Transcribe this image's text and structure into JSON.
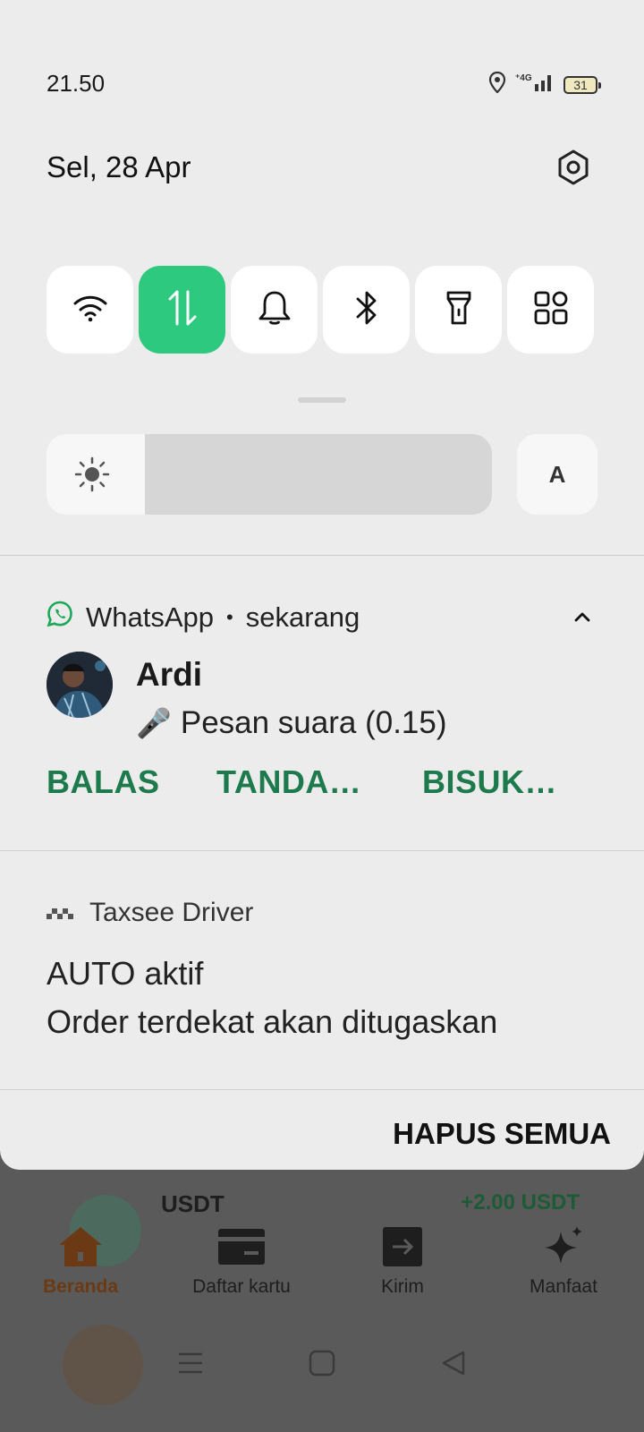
{
  "status_bar": {
    "time": "21.50",
    "network": "4G",
    "battery": "31"
  },
  "header": {
    "date": "Sel, 28 Apr"
  },
  "quick_tiles": [
    {
      "name": "wifi",
      "icon": "wifi-icon",
      "active": false
    },
    {
      "name": "mobile-data",
      "icon": "data-transfer-icon",
      "active": true
    },
    {
      "name": "sound",
      "icon": "bell-icon",
      "active": false
    },
    {
      "name": "bluetooth",
      "icon": "bluetooth-icon",
      "active": false
    },
    {
      "name": "flashlight",
      "icon": "flashlight-icon",
      "active": false
    },
    {
      "name": "more",
      "icon": "grid-icon",
      "active": false
    }
  ],
  "brightness": {
    "level": 0.22,
    "auto_label": "A"
  },
  "notifications": {
    "whatsapp": {
      "app": "WhatsApp",
      "separator": "•",
      "time": "sekarang",
      "sender": "Ardi",
      "emoji": "🎤",
      "message": "Pesan suara (0.15)",
      "actions": [
        "BALAS",
        "TANDA…",
        "BISUK…"
      ]
    },
    "taxsee": {
      "app": "Taxsee Driver",
      "title": "AUTO aktif",
      "text": "Order terdekat akan ditugaskan"
    }
  },
  "clear_all_label": "HAPUS SEMUA",
  "background_app": {
    "row_title": "USDT",
    "row_amount": "+2.00 USDT",
    "nav": [
      {
        "label": "Beranda",
        "icon": "home-icon",
        "active": true
      },
      {
        "label": "Daftar kartu",
        "icon": "card-icon",
        "active": false
      },
      {
        "label": "Kirim",
        "icon": "send-icon",
        "active": false
      },
      {
        "label": "Manfaat",
        "icon": "sparkle-icon",
        "active": false
      }
    ]
  },
  "colors": {
    "accent_green": "#2cc97e",
    "action_green": "#1d7a4d",
    "shade_bg": "#ececec"
  }
}
